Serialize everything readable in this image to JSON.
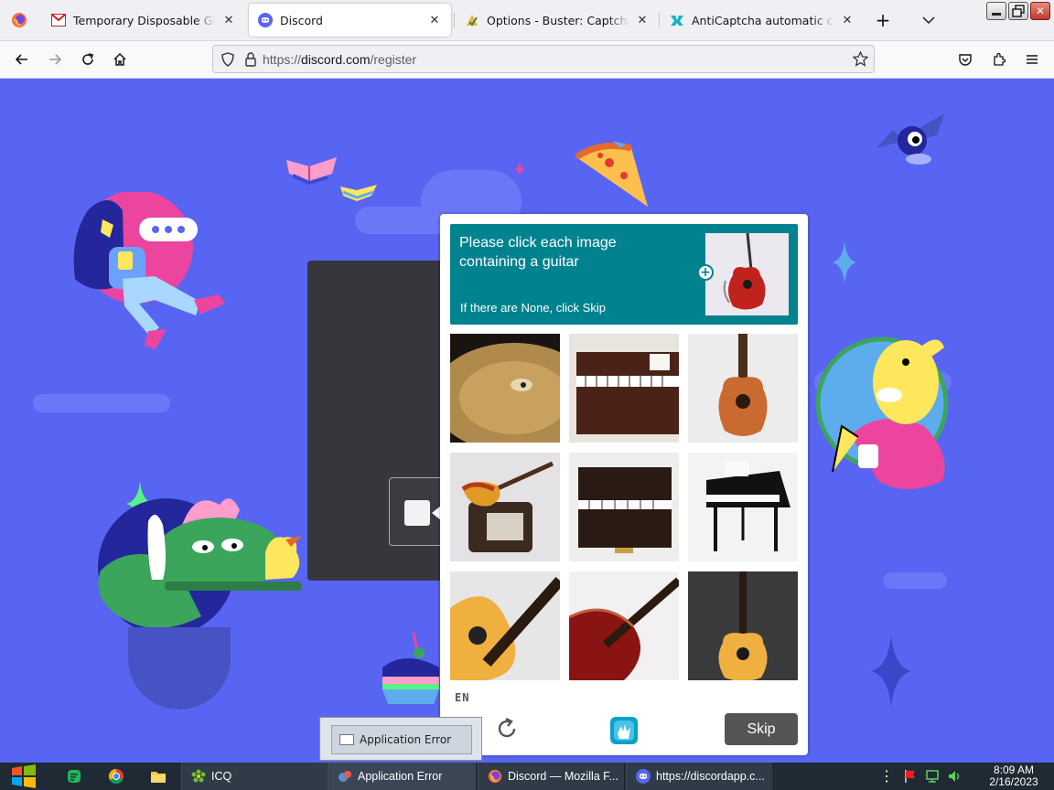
{
  "browser": {
    "tabs": [
      {
        "title": "Temporary Disposable Gmail | ",
        "icon": "gmail-icon",
        "active": false
      },
      {
        "title": "Discord",
        "icon": "discord-icon",
        "active": true
      },
      {
        "title": "Options - Buster: Captcha Sol",
        "icon": "buster-icon",
        "active": false
      },
      {
        "title": "AntiCaptcha automatic captch",
        "icon": "anticaptcha-icon",
        "active": false
      }
    ],
    "url_prefix": "https://",
    "url_domain": "discord.com",
    "url_path": "/register"
  },
  "captcha": {
    "prompt_line1": "Please click each image",
    "prompt_line2": "containing a guitar",
    "hint": "If there are None, click Skip",
    "tiles": [
      "cymbal",
      "upright-piano",
      "acoustic-guitar",
      "electric-guitar",
      "upright-piano",
      "grand-piano",
      "acoustic-guitar",
      "electric-guitar",
      "acoustic-guitar"
    ],
    "language": "EN",
    "skip_label": "Skip"
  },
  "popup": {
    "label": "Application Error"
  },
  "taskbar": {
    "items": [
      {
        "label": "ICQ",
        "icon": "icq-icon"
      },
      {
        "label": "Application Error",
        "icon": "error-app-icon"
      },
      {
        "label": "Discord — Mozilla F...",
        "icon": "firefox-icon"
      },
      {
        "label": "https://discordapp.c...",
        "icon": "discord-icon"
      }
    ],
    "time": "8:09 AM",
    "date": "2/16/2023"
  },
  "colors": {
    "accent": "#5865f2",
    "captcha_teal": "#00838f",
    "skip_gray": "#555555"
  }
}
